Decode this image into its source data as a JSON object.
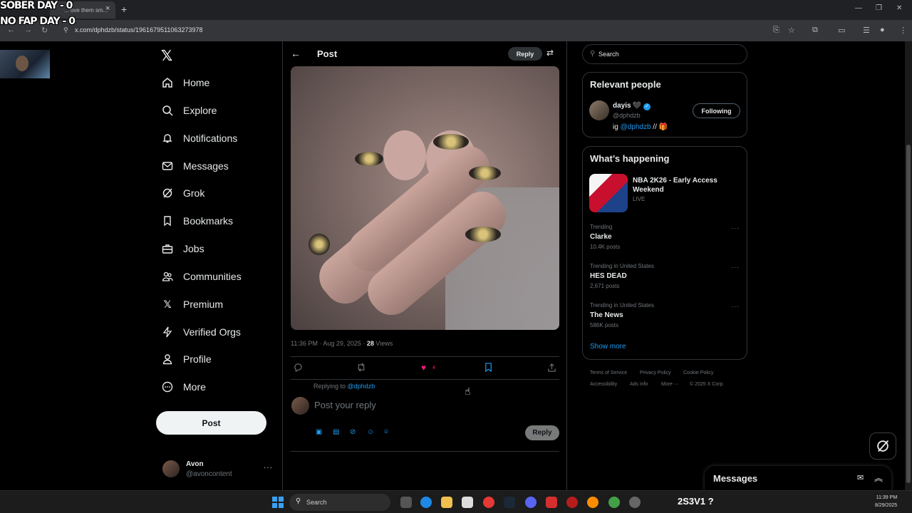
{
  "browser": {
    "tab_title": "... ove them sm...",
    "url": "x.com/dphdzb/status/1961679511063273978"
  },
  "stream_overlay": {
    "sober_day": "SOBER DAY - 0",
    "no_fap_day": "NO FAP DAY - 0",
    "taskbar_text": "2S3V1  ?"
  },
  "sidebar": {
    "items": [
      {
        "label": "Home",
        "icon": "home-icon"
      },
      {
        "label": "Explore",
        "icon": "search-icon"
      },
      {
        "label": "Notifications",
        "icon": "bell-icon"
      },
      {
        "label": "Messages",
        "icon": "envelope-icon"
      },
      {
        "label": "Grok",
        "icon": "grok-icon"
      },
      {
        "label": "Bookmarks",
        "icon": "bookmark-icon"
      },
      {
        "label": "Jobs",
        "icon": "briefcase-icon"
      },
      {
        "label": "Communities",
        "icon": "people-icon"
      },
      {
        "label": "Premium",
        "icon": "x-icon"
      },
      {
        "label": "Verified Orgs",
        "icon": "lightning-icon"
      },
      {
        "label": "Profile",
        "icon": "person-icon"
      },
      {
        "label": "More",
        "icon": "more-circle-icon"
      }
    ],
    "post_button": "Post",
    "account": {
      "name": "Avon",
      "handle": "@avoncontent",
      "more": "···"
    }
  },
  "main": {
    "header_title": "Post",
    "reply_button": "Reply",
    "post_time": "11:36 PM · Aug 29, 2025 · ",
    "views_count": "28",
    "views_label": " Views",
    "like_count": "4",
    "replying_prefix": "Replying to ",
    "replying_to": "@dphdzb",
    "reply_placeholder": "Post your reply",
    "reply_submit": "Reply"
  },
  "right": {
    "search_placeholder": "Search",
    "relevant_title": "Relevant people",
    "relevant_person": {
      "name": "dayis 🖤",
      "handle": "@dphdzb",
      "bio_prefix": "ig ",
      "bio_link": "@dphdzb",
      "bio_suffix": " // 🎁",
      "follow_button": "Following"
    },
    "happening_title": "What’s happening",
    "featured": {
      "title": "NBA 2K26 - Early Access Weekend",
      "status": "LIVE"
    },
    "trends": [
      {
        "context": "Trending",
        "name": "Clarke",
        "count": "10.4K posts"
      },
      {
        "context": "Trending in United States",
        "name": "HES DEAD",
        "count": "2,671 posts"
      },
      {
        "context": "Trending in United States",
        "name": "The News",
        "count": "586K posts"
      }
    ],
    "show_more": "Show more",
    "footer": [
      "Terms of Service",
      "Privacy Policy",
      "Cookie Policy",
      "Accessibility",
      "Ads info",
      "More ···",
      "© 2025 X Corp."
    ],
    "messages_drawer": "Messages"
  },
  "taskbar": {
    "search": "Search",
    "time": "11:39 PM",
    "date": "8/29/2025"
  }
}
